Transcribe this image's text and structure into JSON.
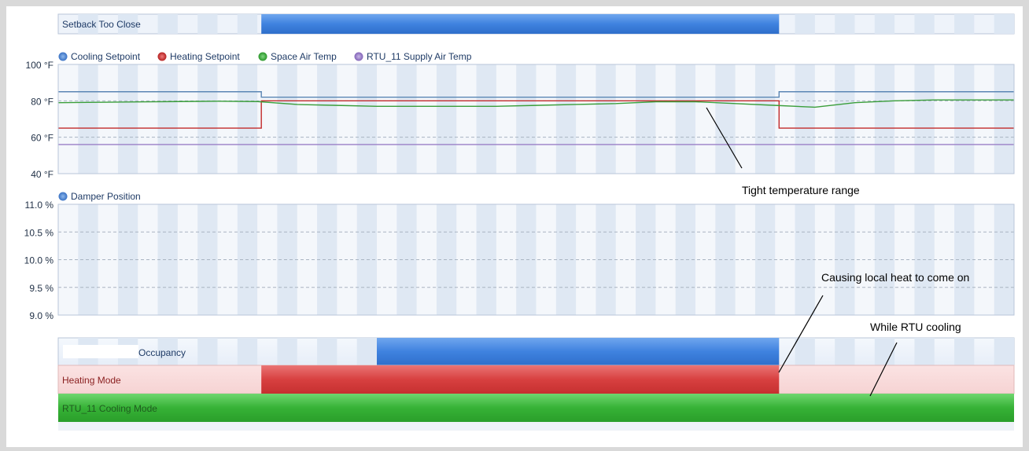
{
  "colors": {
    "setback": "#3f82df",
    "cooling_setpoint": "#5b86b4",
    "heating_setpoint": "#c22a2a",
    "space_air_temp": "#3a9e3a",
    "supply_air_temp": "#9a7fc6",
    "occupancy": "#3f82df",
    "heating_mode": "#d84040",
    "cooling_mode": "#36b236",
    "annotation": "#000000"
  },
  "chart_data": {
    "type": "line",
    "x": [
      0,
      1,
      2,
      3,
      4,
      5,
      6,
      7,
      8,
      9,
      10,
      11,
      12,
      13,
      14,
      15,
      16,
      17,
      18,
      19,
      20,
      21,
      22,
      23,
      24
    ],
    "xlim": [
      0,
      24
    ],
    "bands": [
      {
        "id": "setback",
        "label": "Setback Too Close",
        "spans": [
          [
            5.1,
            18.1
          ]
        ]
      }
    ],
    "temperature_panel": {
      "ylim": [
        40,
        100
      ],
      "yticks": [
        {
          "value": 100,
          "label": "100 °F"
        },
        {
          "value": 80,
          "label": "80 °F"
        },
        {
          "value": 60,
          "label": "60 °F"
        },
        {
          "value": 40,
          "label": "40 °F"
        }
      ],
      "series": [
        {
          "name": "Cooling Setpoint",
          "values": [
            85,
            85,
            85,
            85,
            85,
            85,
            82,
            82,
            82,
            82,
            82,
            82,
            82,
            82,
            82,
            82,
            82,
            82,
            82,
            85,
            85,
            85,
            85,
            85,
            85
          ]
        },
        {
          "name": "Heating Setpoint",
          "values": [
            65,
            65,
            65,
            65,
            65,
            65,
            80,
            80,
            80,
            80,
            80,
            80,
            80,
            80,
            80,
            80,
            80,
            80,
            80,
            65,
            65,
            65,
            65,
            65,
            65
          ]
        },
        {
          "name": "Space Air Temp",
          "values": [
            79,
            79.2,
            79.4,
            79.6,
            79.8,
            79.6,
            78,
            77.5,
            77,
            77,
            77,
            77,
            77.5,
            78,
            78.5,
            79.5,
            79.5,
            78.5,
            77.5,
            76.5,
            79,
            80,
            80.5,
            80.5,
            80.5
          ]
        },
        {
          "name": "RTU_11 Supply Air Temp",
          "values": [
            56,
            56,
            56,
            56,
            56,
            56,
            56,
            56,
            56,
            56,
            56,
            56,
            56,
            56,
            56,
            56,
            56,
            56,
            56,
            56,
            56,
            56,
            56,
            56,
            56
          ]
        }
      ]
    },
    "damper_panel": {
      "ylim": [
        9.0,
        11.0
      ],
      "yticks": [
        {
          "value": 11.0,
          "label": "11.0 %"
        },
        {
          "value": 10.5,
          "label": "10.5 %"
        },
        {
          "value": 10.0,
          "label": "10.0 %"
        },
        {
          "value": 9.5,
          "label": "9.5 %"
        },
        {
          "value": 9.0,
          "label": "9.0 %"
        }
      ],
      "series": [
        {
          "name": "Damper Position",
          "values": []
        }
      ]
    },
    "state_rows": [
      {
        "id": "occupancy",
        "label": "Occupancy",
        "spans": [
          [
            8.0,
            18.1
          ]
        ]
      },
      {
        "id": "heating_mode",
        "label": "Heating Mode",
        "spans": [
          [
            5.1,
            18.1
          ]
        ]
      },
      {
        "id": "cooling_mode",
        "label": "RTU_11 Cooling Mode",
        "spans": [
          [
            0,
            24
          ]
        ]
      }
    ],
    "annotations": [
      {
        "id": "tight-range",
        "text": "Tight temperature range"
      },
      {
        "id": "local-heat",
        "text": "Causing local heat to come on"
      },
      {
        "id": "rtu-cooling",
        "text": "While RTU cooling"
      }
    ]
  }
}
